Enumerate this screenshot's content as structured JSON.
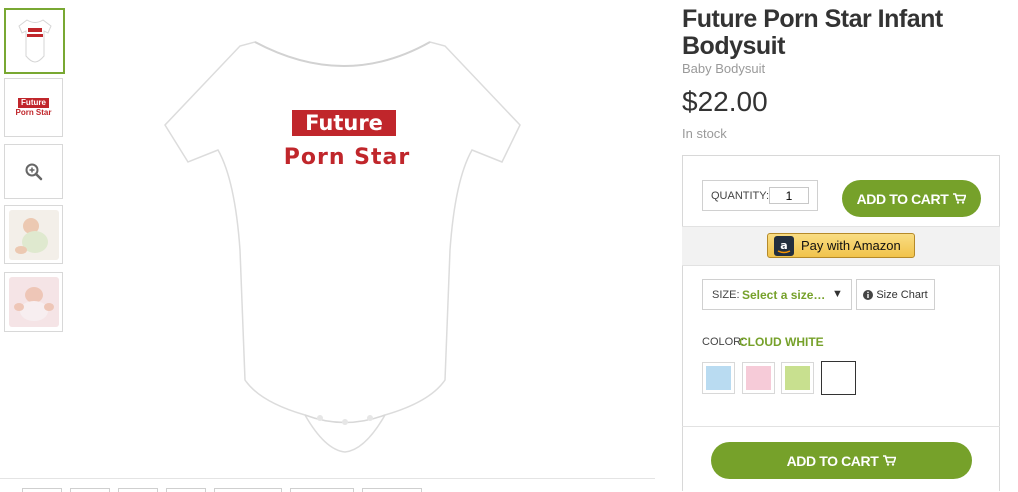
{
  "thumbnails": [
    {
      "type": "product",
      "print_line1": "Future",
      "print_line2": "Porn Star"
    },
    {
      "type": "design",
      "print_line1": "Future",
      "print_line2": "Porn Star"
    },
    {
      "type": "zoom",
      "icon": "zoom-in-icon"
    },
    {
      "type": "photo",
      "icon": "baby-photo"
    },
    {
      "type": "photo",
      "icon": "baby-photo"
    }
  ],
  "product_print": {
    "line1": "Future",
    "line2": "Porn Star"
  },
  "product": {
    "title": "Future Porn Star Infant Bodysuit",
    "subtitle": "Baby Bodysuit",
    "price": "$22.00",
    "stock": "In stock"
  },
  "purchase": {
    "quantity_label": "QUANTITY:",
    "quantity_value": "1",
    "add_to_cart_label": "ADD TO CART",
    "amazon_label": "Pay with Amazon",
    "size_label": "SIZE:",
    "size_value": "Select a size…",
    "size_chart_label": "Size Chart",
    "color_label": "COLOR:",
    "color_value": "CLOUD WHITE",
    "swatches": [
      {
        "name": "light-blue",
        "color": "#b9dbf1"
      },
      {
        "name": "pink",
        "color": "#f6cbd8"
      },
      {
        "name": "green",
        "color": "#c8e08f"
      },
      {
        "name": "cloud-white",
        "color": "#ffffff"
      }
    ],
    "bottom_add_to_cart_label": "ADD TO CART"
  },
  "colors": {
    "accent_green": "#76a12a",
    "print_red": "#c0262b"
  }
}
